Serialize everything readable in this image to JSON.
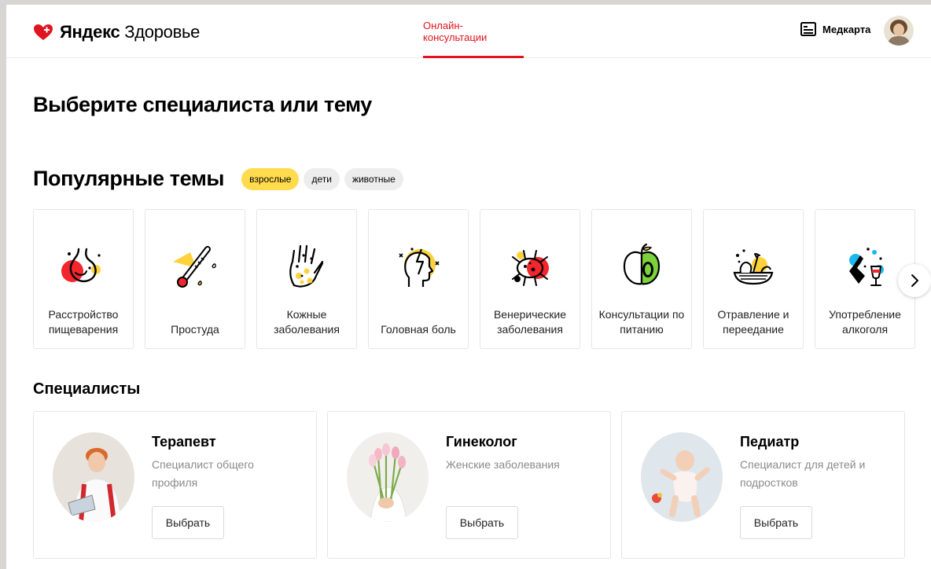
{
  "header": {
    "logo_brand": "Яндекс",
    "logo_product": "Здоровье",
    "nav_tab": "Онлайн-консультации",
    "medcard": "Медкарта"
  },
  "main_title": "Выберите специалиста или тему",
  "popular": {
    "title": "Популярные темы",
    "chips": [
      {
        "label": "взрослые",
        "active": true
      },
      {
        "label": "дети",
        "active": false
      },
      {
        "label": "животные",
        "active": false
      }
    ],
    "topics": [
      {
        "label": "Расстройство пищеварения",
        "icon": "stomach-icon"
      },
      {
        "label": "Простуда",
        "icon": "thermometer-icon"
      },
      {
        "label": "Кожные заболевания",
        "icon": "hand-skin-icon"
      },
      {
        "label": "Головная боль",
        "icon": "head-pain-icon"
      },
      {
        "label": "Венерические заболевания",
        "icon": "virus-icon"
      },
      {
        "label": "Консультации по питанию",
        "icon": "apple-icon"
      },
      {
        "label": "Отравление и переедание",
        "icon": "food-plate-icon"
      },
      {
        "label": "Употребление алкоголя",
        "icon": "bottle-glass-icon"
      }
    ]
  },
  "specialists": {
    "title": "Специалисты",
    "items": [
      {
        "name": "Терапевт",
        "desc": "Специалист общего профиля",
        "button": "Выбрать"
      },
      {
        "name": "Гинеколог",
        "desc": "Женские заболевания",
        "button": "Выбрать"
      },
      {
        "name": "Педиатр",
        "desc": "Специалист для детей и подростков",
        "button": "Выбрать"
      }
    ]
  },
  "colors": {
    "accent_red": "#e0141e",
    "chip_active": "#ffdb4d",
    "chip_inactive": "#ededed"
  }
}
